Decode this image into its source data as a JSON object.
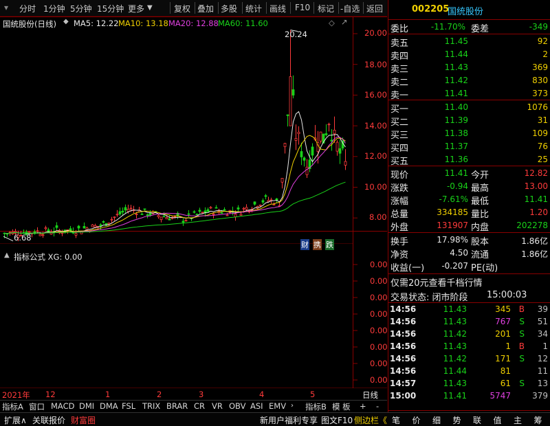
{
  "toolbar": {
    "left_items": [
      "分时",
      "1分钟",
      "5分钟",
      "15分钟",
      "更多"
    ],
    "right_items": [
      "复权",
      "叠加",
      "多股",
      "统计",
      "画线",
      "F10",
      "标记",
      "-自选",
      "返回"
    ]
  },
  "main_chart": {
    "title": "国统股份(日线)",
    "ma5": "MA5: 12.22",
    "ma10": "MA10: 13.18",
    "ma20": "MA20: 12.88",
    "ma60": "MA60: 11.60",
    "y_ticks": [
      "20.00",
      "18.00",
      "16.00",
      "14.00",
      "12.00",
      "10.00",
      "8.00"
    ],
    "high_label": "20.24",
    "low_label": "6.68",
    "badges": [
      "财",
      "携",
      "跌"
    ]
  },
  "indicator": {
    "title": "指标公式 XG: 0.00",
    "y_ticks": [
      "0.00",
      "0.00",
      "0.00",
      "0.00",
      "0.00",
      "0.00",
      "0.00",
      "0.00"
    ]
  },
  "time_axis": {
    "labels": [
      "2021年",
      "12",
      "1",
      "2",
      "3",
      "4",
      "5"
    ],
    "period": "日线"
  },
  "tabs": [
    "指标A",
    "窗口",
    "MACD",
    "DMI",
    "DMA",
    "FSL",
    "TRIX",
    "BRAR",
    "CR",
    "VR",
    "OBV",
    "ASI",
    "EMV"
  ],
  "tabs_right": [
    "指标B",
    "模 板",
    "+",
    "-"
  ],
  "colors": {
    "up": "#ff3b3b",
    "down": "#19d219",
    "ma5": "#e8e8e8",
    "ma10": "#f0d000",
    "ma20": "#e040e0",
    "ma60": "#19d219",
    "axis": "#8a0000"
  },
  "quote": {
    "code": "002205",
    "name": "国统股份",
    "webi_label": "委比",
    "webi_value": "-11.70%",
    "weicha_label": "委差",
    "weicha_value": "-349",
    "asks": [
      {
        "label": "卖五",
        "price": "11.45",
        "vol": "92"
      },
      {
        "label": "卖四",
        "price": "11.44",
        "vol": "2"
      },
      {
        "label": "卖三",
        "price": "11.43",
        "vol": "369"
      },
      {
        "label": "卖二",
        "price": "11.42",
        "vol": "830"
      },
      {
        "label": "卖一",
        "price": "11.41",
        "vol": "373"
      }
    ],
    "bids": [
      {
        "label": "买一",
        "price": "11.40",
        "vol": "1076"
      },
      {
        "label": "买二",
        "price": "11.39",
        "vol": "31"
      },
      {
        "label": "买三",
        "price": "11.38",
        "vol": "109"
      },
      {
        "label": "买四",
        "price": "11.37",
        "vol": "76"
      },
      {
        "label": "买五",
        "price": "11.36",
        "vol": "25"
      }
    ],
    "stats": [
      {
        "l1": "现价",
        "v1": "11.41",
        "c1": "green",
        "l2": "今开",
        "v2": "12.82",
        "c2": "red"
      },
      {
        "l1": "涨跌",
        "v1": "-0.94",
        "c1": "green",
        "l2": "最高",
        "v2": "13.00",
        "c2": "red"
      },
      {
        "l1": "涨幅",
        "v1": "-7.61%",
        "c1": "green",
        "l2": "最低",
        "v2": "11.41",
        "c2": "green"
      },
      {
        "l1": "总量",
        "v1": "334185",
        "c1": "yellow",
        "l2": "量比",
        "v2": "1.20",
        "c2": "red"
      },
      {
        "l1": "外盘",
        "v1": "131907",
        "c1": "red",
        "l2": "内盘",
        "v2": "202278",
        "c2": "green"
      }
    ],
    "stats2": [
      {
        "l1": "换手",
        "v1": "17.98%",
        "l2": "股本",
        "v2": "1.86亿"
      },
      {
        "l1": "净资",
        "v1": "4.50",
        "l2": "流通",
        "v2": "1.86亿"
      },
      {
        "l1": "收益(一)",
        "v1": "-0.207",
        "l2": "PE(动)",
        "v2": ""
      }
    ],
    "promo": "仅需20元查看千档行情",
    "trade_status_label": "交易状态: 闭市阶段",
    "trade_status_time": "15:00:03",
    "ticks": [
      {
        "time": "14:56",
        "price": "11.43",
        "vol": "345",
        "bs": "B",
        "n": "39",
        "vc": "yellow"
      },
      {
        "time": "14:56",
        "price": "11.43",
        "vol": "767",
        "bs": "S",
        "n": "51",
        "vc": "magenta"
      },
      {
        "time": "14:56",
        "price": "11.42",
        "vol": "201",
        "bs": "S",
        "n": "34",
        "vc": "yellow"
      },
      {
        "time": "14:56",
        "price": "11.43",
        "vol": "1",
        "bs": "B",
        "n": "1",
        "vc": "yellow"
      },
      {
        "time": "14:56",
        "price": "11.42",
        "vol": "171",
        "bs": "S",
        "n": "12",
        "vc": "yellow"
      },
      {
        "time": "14:56",
        "price": "11.44",
        "vol": "81",
        "bs": "",
        "n": "11",
        "vc": "yellow"
      },
      {
        "time": "14:57",
        "price": "11.43",
        "vol": "61",
        "bs": "S",
        "n": "13",
        "vc": "yellow"
      },
      {
        "time": "15:00",
        "price": "11.41",
        "vol": "5747",
        "bs": "",
        "n": "379",
        "vc": "magenta"
      }
    ],
    "tabs": [
      "笔",
      "价",
      "细",
      "势",
      "联",
      "值",
      "主",
      "筹"
    ]
  },
  "statusbar": {
    "left": [
      "扩展∧",
      "关联报价",
      "财富圈"
    ],
    "right": [
      "新用户福利专享",
      "图文F10",
      "侧边栏《"
    ]
  }
}
